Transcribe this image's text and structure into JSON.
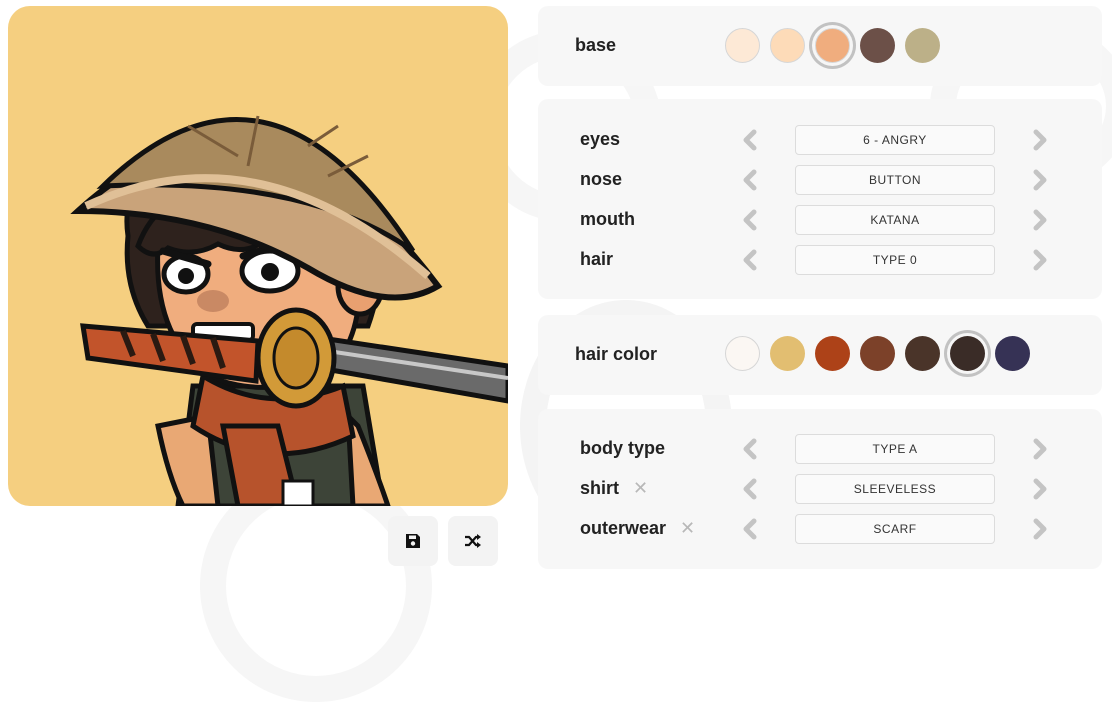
{
  "base": {
    "label": "base",
    "swatches": [
      {
        "color": "#fde9d6",
        "selected": false
      },
      {
        "color": "#fddbb8",
        "selected": false
      },
      {
        "color": "#f0ad7e",
        "selected": true
      },
      {
        "color": "#6c5048",
        "selected": false
      },
      {
        "color": "#bcb088",
        "selected": false
      }
    ]
  },
  "face": [
    {
      "label": "eyes",
      "value": "6 - ANGRY"
    },
    {
      "label": "nose",
      "value": "BUTTON"
    },
    {
      "label": "mouth",
      "value": "KATANA"
    },
    {
      "label": "hair",
      "value": "TYPE 0"
    }
  ],
  "hair_color": {
    "label": "hair color",
    "swatches": [
      {
        "color": "#fbf7f3",
        "selected": false
      },
      {
        "color": "#e2be71",
        "selected": false
      },
      {
        "color": "#ad4218",
        "selected": false
      },
      {
        "color": "#7c4129",
        "selected": false
      },
      {
        "color": "#4a3429",
        "selected": false
      },
      {
        "color": "#3a2c27",
        "selected": true
      },
      {
        "color": "#363255",
        "selected": false
      }
    ]
  },
  "body": [
    {
      "label": "body type",
      "value": "TYPE A",
      "removable": false
    },
    {
      "label": "shirt",
      "value": "SLEEVELESS",
      "removable": true
    },
    {
      "label": "outerwear",
      "value": "SCARF",
      "removable": true
    }
  ],
  "remove_glyph": "✕",
  "icons": {
    "save": "save-icon",
    "shuffle": "shuffle-icon",
    "prev": "chevron-left-icon",
    "next": "chevron-right-icon"
  }
}
